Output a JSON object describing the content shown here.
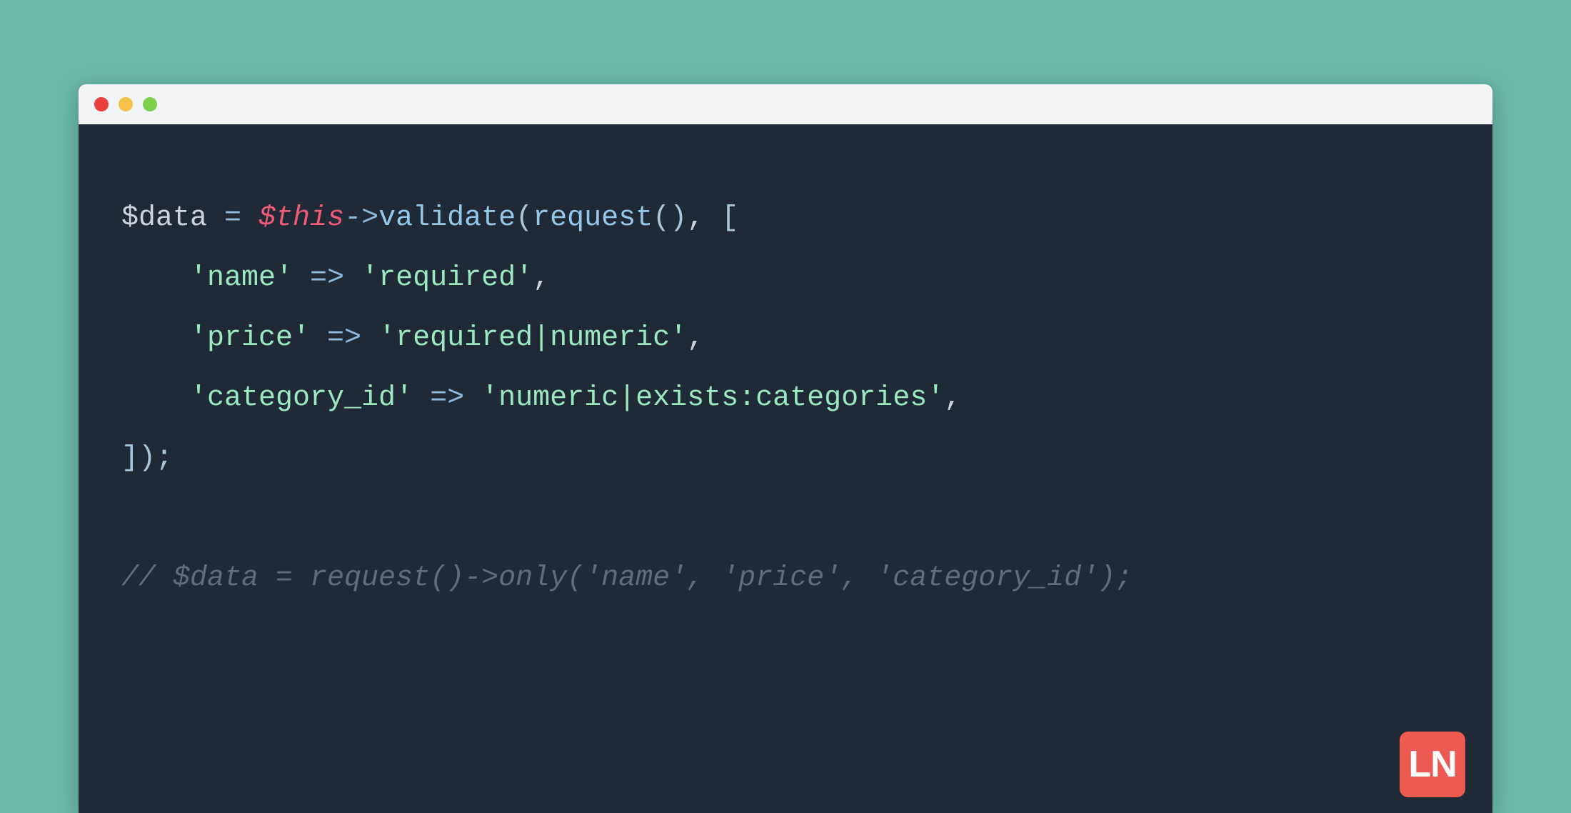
{
  "code": {
    "line1": {
      "var": "$data",
      "eq": " = ",
      "this": "$this",
      "arrow": "->",
      "func": "validate",
      "open": "(",
      "req": "request",
      "reqp": "()",
      "comma1": ", ",
      "brack": "["
    },
    "line2": {
      "indent": "    ",
      "key": "'name'",
      "arrow": " => ",
      "val": "'required'",
      "comma": ","
    },
    "line3": {
      "indent": "    ",
      "key": "'price'",
      "arrow": " => ",
      "val": "'required|numeric'",
      "comma": ","
    },
    "line4": {
      "indent": "    ",
      "key": "'category_id'",
      "arrow": " => ",
      "val": "'numeric|exists:categories'",
      "comma": ","
    },
    "line5": {
      "close": "]);"
    },
    "blank": "",
    "line7": {
      "comment": "// $data = request()->only('name', 'price', 'category_id');"
    }
  },
  "logo": "LN"
}
